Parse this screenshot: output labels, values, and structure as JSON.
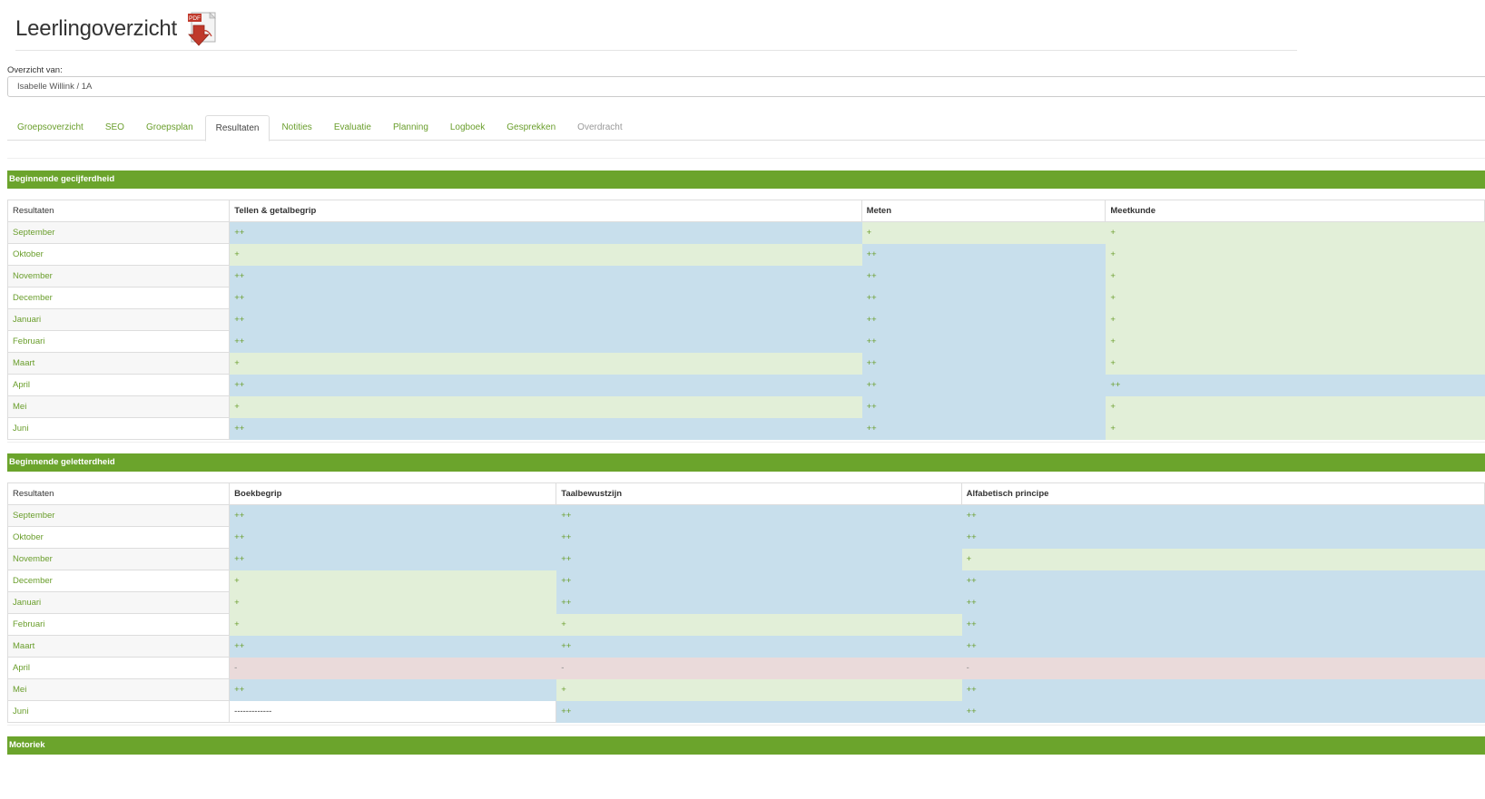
{
  "page": {
    "title": "Leerlingoverzicht",
    "pdf_icon": "pdf-download-icon",
    "pdf_icon_label": "PDF"
  },
  "overview": {
    "label": "Overzicht van:",
    "value": "Isabelle Willink / 1A"
  },
  "tabs": [
    {
      "label": "Groepsoverzicht",
      "state": "normal"
    },
    {
      "label": "SEO",
      "state": "normal"
    },
    {
      "label": "Groepsplan",
      "state": "normal"
    },
    {
      "label": "Resultaten",
      "state": "active"
    },
    {
      "label": "Notities",
      "state": "normal"
    },
    {
      "label": "Evaluatie",
      "state": "normal"
    },
    {
      "label": "Planning",
      "state": "normal"
    },
    {
      "label": "Logboek",
      "state": "normal"
    },
    {
      "label": "Gesprekken",
      "state": "normal"
    },
    {
      "label": "Overdracht",
      "state": "disabled"
    }
  ],
  "colors": {
    "accent_green": "#6ba42c",
    "score_plusplus": "#c8dfec",
    "score_plus": "#e2efd8",
    "score_minus": "#eadada"
  },
  "sections": [
    {
      "title": "Beginnende gecijferdheid",
      "first_header": "Resultaten",
      "columns": [
        "Tellen & getalbegrip",
        "Meten",
        "Meetkunde"
      ],
      "rows": [
        {
          "month": "September",
          "values": [
            "++",
            "+",
            "+"
          ]
        },
        {
          "month": "Oktober",
          "values": [
            "+",
            "++",
            "+"
          ]
        },
        {
          "month": "November",
          "values": [
            "++",
            "++",
            "+"
          ]
        },
        {
          "month": "December",
          "values": [
            "++",
            "++",
            "+"
          ]
        },
        {
          "month": "Januari",
          "values": [
            "++",
            "++",
            "+"
          ]
        },
        {
          "month": "Februari",
          "values": [
            "++",
            "++",
            "+"
          ]
        },
        {
          "month": "Maart",
          "values": [
            "+",
            "++",
            "+"
          ]
        },
        {
          "month": "April",
          "values": [
            "++",
            "++",
            "++"
          ]
        },
        {
          "month": "Mei",
          "values": [
            "+",
            "++",
            "+"
          ]
        },
        {
          "month": "Juni",
          "values": [
            "++",
            "++",
            "+"
          ]
        }
      ]
    },
    {
      "title": "Beginnende geletterdheid",
      "first_header": "Resultaten",
      "columns": [
        "Boekbegrip",
        "Taalbewustzijn",
        "Alfabetisch principe"
      ],
      "rows": [
        {
          "month": "September",
          "values": [
            "++",
            "++",
            "++"
          ]
        },
        {
          "month": "Oktober",
          "values": [
            "++",
            "++",
            "++"
          ]
        },
        {
          "month": "November",
          "values": [
            "++",
            "++",
            "+"
          ]
        },
        {
          "month": "December",
          "values": [
            "+",
            "++",
            "++"
          ]
        },
        {
          "month": "Januari",
          "values": [
            "+",
            "++",
            "++"
          ]
        },
        {
          "month": "Februari",
          "values": [
            "+",
            "+",
            "++"
          ]
        },
        {
          "month": "Maart",
          "values": [
            "++",
            "++",
            "++"
          ]
        },
        {
          "month": "April",
          "values": [
            "-",
            "-",
            "-"
          ]
        },
        {
          "month": "Mei",
          "values": [
            "++",
            "+",
            "++"
          ]
        },
        {
          "month": "Juni",
          "values": [
            "-------------",
            "++",
            "++"
          ]
        }
      ]
    },
    {
      "title": "Motoriek"
    }
  ]
}
